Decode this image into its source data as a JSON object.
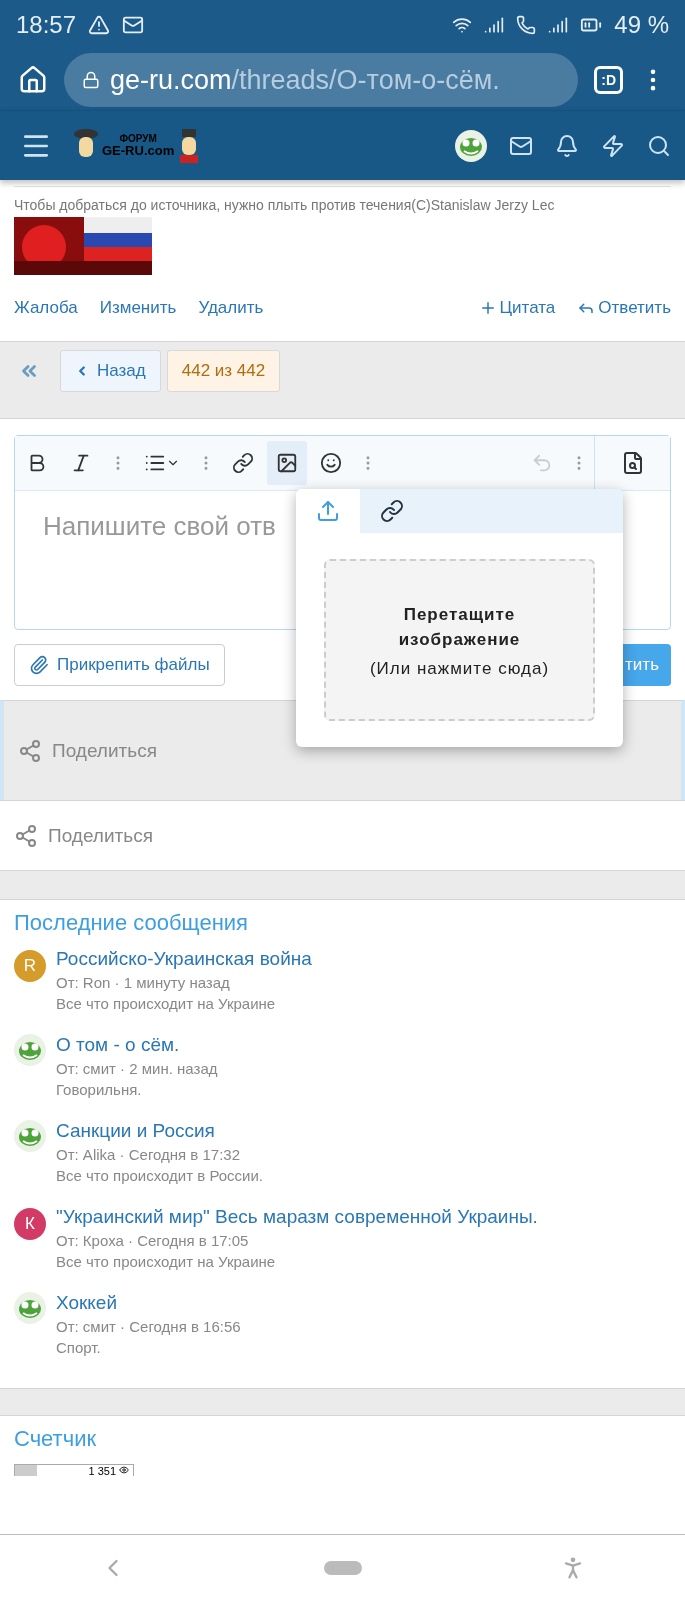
{
  "status_bar": {
    "time": "18:57",
    "battery": "49 %"
  },
  "browser": {
    "url_host": "ge-ru.com",
    "url_path": "/threads/О-том-о-сём.",
    "tab_badge": ":D"
  },
  "forum_header": {
    "logo_top": "ФОРУМ",
    "logo_bottom": "GE-RU.com"
  },
  "post": {
    "signature": "Чтобы добраться до источника, нужно плыть против течения(С)Stanislaw Jerzy Lec",
    "actions_left": [
      "Жалоба",
      "Изменить",
      "Удалить"
    ],
    "quote": "Цитата",
    "reply": "Ответить"
  },
  "pagination": {
    "back": "Назад",
    "position": "442 из 442"
  },
  "editor": {
    "placeholder_visible": "Напишите свой отв",
    "image_button_active": true,
    "popup": {
      "tabs": [
        {
          "kind": "upload",
          "selected": true
        },
        {
          "kind": "link",
          "selected": false
        }
      ],
      "drop_title": "Перетащите изображение",
      "drop_hint": "(Или нажмите сюда)"
    },
    "attach": "Прикрепить файлы",
    "send_visible": "тить"
  },
  "share": [
    {
      "label": "Поделиться",
      "shaded": true
    },
    {
      "label": "Поделиться",
      "shaded": false
    }
  ],
  "latest": {
    "title": "Последние сообщения",
    "items": [
      {
        "avatar": {
          "kind": "letter",
          "letter": "R",
          "color": "#d59b2b"
        },
        "title": "Российско-Украинская война",
        "meta": "От: Ron · 1 минуту назад",
        "forum": "Все что происходит на Украине"
      },
      {
        "title": "О том - о сём.",
        "meta": "От: смит · 2 мин. назад",
        "forum": "Говорильня."
      },
      {
        "title": "Санкции и Россия",
        "meta": "От: Alika · Сегодня в 17:32",
        "forum": "Все что происходит в России."
      },
      {
        "avatar": {
          "kind": "letter",
          "letter": "К",
          "color": "#d23b65"
        },
        "title": "\"Украинский мир\" Весь маразм современной Украины.",
        "meta": "От: Кроха · Сегодня в 17:05",
        "forum": "Все что происходит на Украине"
      },
      {
        "title": "Хоккей",
        "meta": "От: смит · Сегодня в 16:56",
        "forum": "Спорт."
      }
    ]
  },
  "counter": {
    "title": "Счетчик",
    "value": "1 351"
  }
}
